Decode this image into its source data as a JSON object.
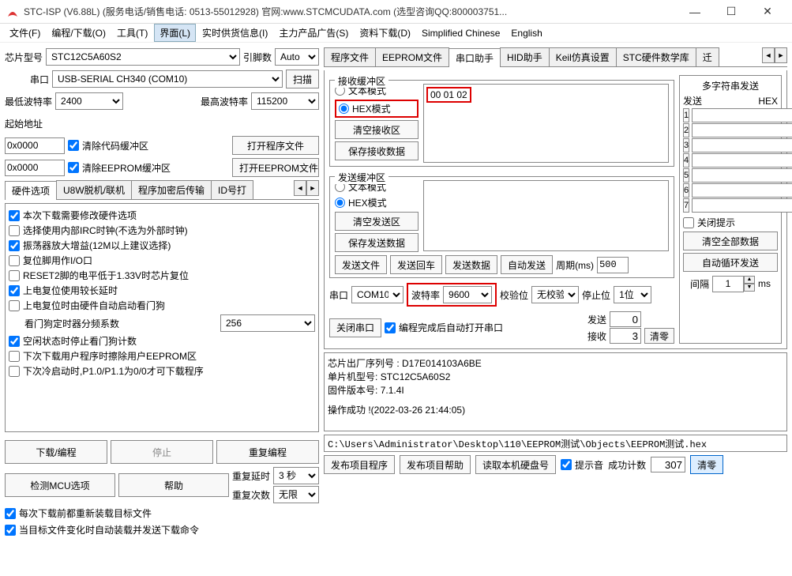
{
  "title": "STC-ISP (V6.88L) (服务电话/销售电话: 0513-55012928) 官网:www.STCMCUDATA.com (选型咨询QQ:800003751...",
  "menu": [
    "文件(F)",
    "编程/下载(O)",
    "工具(T)",
    "界面(L)",
    "实时供货信息(I)",
    "主力产品广告(S)",
    "资料下载(D)",
    "Simplified Chinese",
    "English"
  ],
  "menu_active": 3,
  "chip": {
    "label": "芯片型号",
    "value": "STC12C5A60S2",
    "pincount_lbl": "引脚数",
    "pincount": "Auto"
  },
  "port": {
    "label": "串口",
    "value": "USB-SERIAL CH340 (COM10)",
    "scan": "扫描"
  },
  "baud": {
    "min_lbl": "最低波特率",
    "min": "2400",
    "max_lbl": "最高波特率",
    "max": "115200"
  },
  "addr": {
    "start_lbl": "起始地址",
    "code_addr": "0x0000",
    "code_chk": "清除代码缓冲区",
    "open_code": "打开程序文件",
    "eep_addr": "0x0000",
    "eep_chk": "清除EEPROM缓冲区",
    "open_eep": "打开EEPROM文件"
  },
  "hw_tabs": [
    "硬件选项",
    "U8W脱机/联机",
    "程序加密后传输",
    "ID号打"
  ],
  "hw_opts": [
    {
      "c": true,
      "t": "本次下载需要修改硬件选项"
    },
    {
      "c": false,
      "t": "选择使用内部IRC时钟(不选为外部时钟)"
    },
    {
      "c": true,
      "t": "振荡器放大增益(12M以上建议选择)"
    },
    {
      "c": false,
      "t": "复位脚用作I/O口"
    },
    {
      "c": false,
      "t": "RESET2脚的电平低于1.33V时芯片复位"
    },
    {
      "c": true,
      "t": "上电复位使用较长延时"
    },
    {
      "c": false,
      "t": "上电复位时由硬件自动启动看门狗"
    },
    {
      "c": null,
      "t": "看门狗定时器分频系数",
      "sel": "256"
    },
    {
      "c": true,
      "t": "空闲状态时停止看门狗计数"
    },
    {
      "c": false,
      "t": "下次下载用户程序时擦除用户EEPROM区"
    },
    {
      "c": false,
      "t": "下次冷启动时,P1.0/P1.1为0/0才可下载程序"
    }
  ],
  "dl_btns": {
    "dl": "下载/编程",
    "stop": "停止",
    "redo": "重复编程",
    "detect": "检测MCU选项",
    "help": "帮助",
    "redo_delay_lbl": "重复延时",
    "redo_delay": "3 秒",
    "redo_cnt_lbl": "重复次数",
    "redo_cnt": "无限"
  },
  "dl_chk": {
    "reload": "每次下载前都重新装载目标文件",
    "autoload": "当目标文件变化时自动装载并发送下载命令"
  },
  "right_tabs": [
    "程序文件",
    "EEPROM文件",
    "串口助手",
    "HID助手",
    "Keil仿真设置",
    "STC硬件数学库",
    "迁"
  ],
  "right_active": 2,
  "rx": {
    "title": "接收缓冲区",
    "text_mode": "文本模式",
    "hex_mode": "HEX模式",
    "clear": "清空接收区",
    "save": "保存接收数据",
    "content": "00 01 02"
  },
  "tx": {
    "title": "发送缓冲区",
    "text_mode": "文本模式",
    "hex_mode": "HEX模式",
    "clear": "清空发送区",
    "save": "保存发送数据",
    "content": ""
  },
  "tx_btns": {
    "file": "发送文件",
    "cr": "发送回车",
    "send": "发送数据",
    "auto": "自动发送",
    "period_lbl": "周期(ms)",
    "period": "500"
  },
  "ser": {
    "port_lbl": "串口",
    "port": "COM10",
    "baud_lbl": "波特率",
    "baud": "9600",
    "parity_lbl": "校验位",
    "parity": "无校验",
    "stop_lbl": "停止位",
    "stop": "1位",
    "close": "关闭串口",
    "auto_open": "编程完成后自动打开串口",
    "tx_lbl": "发送",
    "tx_cnt": "0",
    "rx_lbl": "接收",
    "rx_cnt": "3",
    "clear": "清零"
  },
  "ms": {
    "title": "多字符串发送",
    "send_hdr": "发送",
    "hex_hdr": "HEX",
    "rows": [
      "1",
      "2",
      "3",
      "4",
      "5",
      "6",
      "7"
    ],
    "close_tip": "关闭提示",
    "clear_all": "清空全部数据",
    "auto_loop": "自动循环发送",
    "interval_lbl": "间隔",
    "interval": "1",
    "ms": "ms"
  },
  "log": {
    "l1": "芯片出厂序列号 :",
    "v1": "D17E014103A6BE",
    "l2": "单片机型号:",
    "v2": "STC12C5A60S2",
    "l3": "固件版本号:",
    "v3": "7.1.4I",
    "l4": "操作成功 !(2022-03-26 21:44:05)"
  },
  "path": "C:\\Users\\Administrator\\Desktop\\110\\EEPROM测试\\Objects\\EEPROM测试.hex",
  "foot": {
    "pub": "发布项目程序",
    "pubhelp": "发布项目帮助",
    "readhd": "读取本机硬盘号",
    "beep": "提示音",
    "succ_lbl": "成功计数",
    "succ": "307",
    "clear": "清零"
  }
}
